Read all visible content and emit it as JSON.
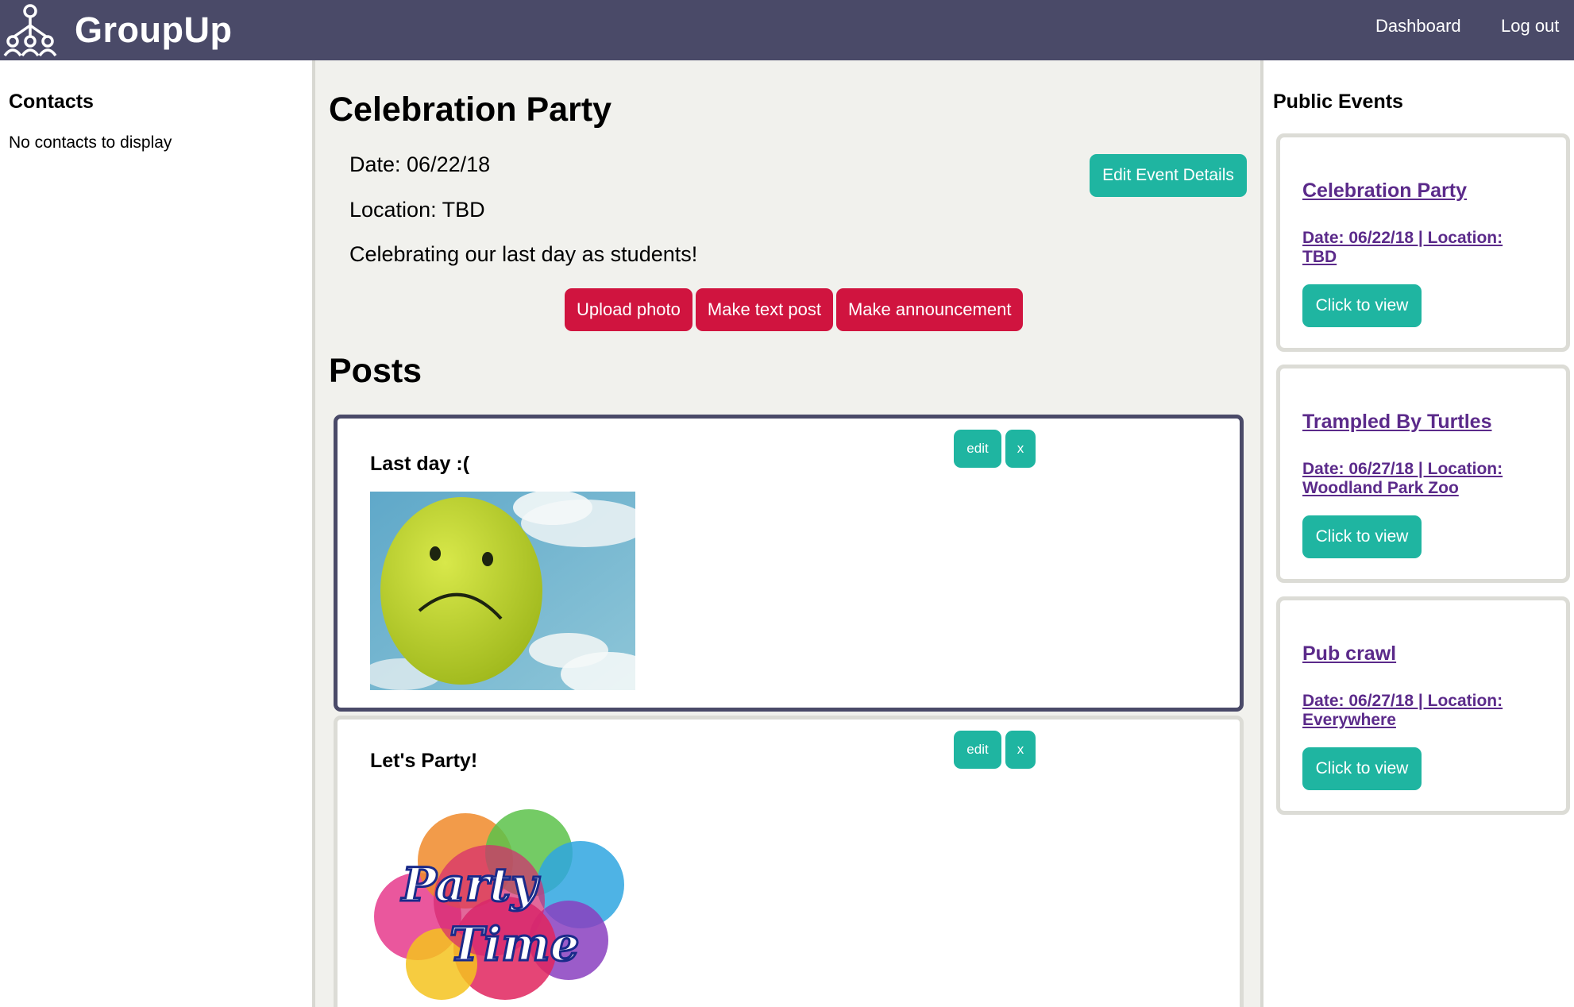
{
  "navbar": {
    "brand_name": "GroupUp",
    "brand_icon": "group-people-icon",
    "links": [
      "Dashboard",
      "Log out"
    ]
  },
  "contacts": {
    "title": "Contacts",
    "empty_text": "No contacts to display"
  },
  "event": {
    "title": "Celebration Party",
    "date": "Date: 06/22/18",
    "location": "Location: TBD",
    "description": "Celebrating our last day as students!",
    "edit_button": "Edit Event Details",
    "actions": [
      "Upload photo",
      "Make text post",
      "Make announcement"
    ]
  },
  "posts": {
    "title": "Posts",
    "items": [
      {
        "title": "Last day :(",
        "edit_label": "edit",
        "delete_label": "x",
        "image": "sad-balloon-image"
      },
      {
        "title": "Let's Party!",
        "edit_label": "edit",
        "delete_label": "x",
        "image": "party-time-image"
      }
    ]
  },
  "public_events": {
    "title": "Public Events",
    "items": [
      {
        "name": "Celebration Party",
        "meta": "Date: 06/22/18 | Location: TBD",
        "button": "Click to view"
      },
      {
        "name": "Trampled By Turtles",
        "meta": "Date: 06/27/18 | Location: Woodland Park Zoo",
        "button": "Click to view"
      },
      {
        "name": "Pub crawl",
        "meta": "Date: 06/27/18 | Location: Everywhere",
        "button": "Click to view"
      }
    ]
  },
  "colors": {
    "navbar": "#4a4a68",
    "teal": "#1fb5a1",
    "red": "#d0143f",
    "link_purple": "#5b2a8a",
    "main_bg": "#f1f1ed"
  }
}
